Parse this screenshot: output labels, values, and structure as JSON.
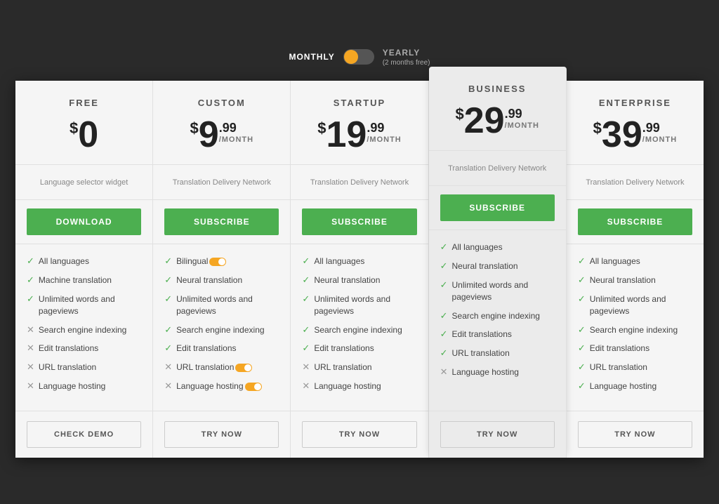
{
  "billing": {
    "monthly_label": "MONTHLY",
    "yearly_label": "YEARLY",
    "yearly_sub": "(2 months free)"
  },
  "plans": [
    {
      "id": "free",
      "name": "FREE",
      "price_symbol": "$",
      "price_amount": "0",
      "price_cents": null,
      "price_month": null,
      "featured": false,
      "description": "Language selector widget",
      "cta_label": "DOWNLOAD",
      "cta_type": "download",
      "features": [
        {
          "check": true,
          "text": "All languages",
          "badge": false
        },
        {
          "check": true,
          "text": "Machine translation",
          "badge": false
        },
        {
          "check": true,
          "text": "Unlimited words and pageviews",
          "badge": false
        },
        {
          "check": false,
          "text": "Search engine indexing",
          "badge": false
        },
        {
          "check": false,
          "text": "Edit translations",
          "badge": false
        },
        {
          "check": false,
          "text": "URL translation",
          "badge": false
        },
        {
          "check": false,
          "text": "Language hosting",
          "badge": false
        }
      ],
      "footer_label": "CHECK DEMO",
      "footer_type": "check-demo"
    },
    {
      "id": "custom",
      "name": "CUSTOM",
      "price_symbol": "$",
      "price_amount": "9",
      "price_cents": ".99",
      "price_month": "/MONTH",
      "featured": false,
      "description": "Translation Delivery Network",
      "cta_label": "SUBSCRIBE",
      "cta_type": "subscribe",
      "features": [
        {
          "check": true,
          "text": "Bilingual",
          "badge": true
        },
        {
          "check": true,
          "text": "Neural translation",
          "badge": false
        },
        {
          "check": true,
          "text": "Unlimited words and pageviews",
          "badge": false
        },
        {
          "check": true,
          "text": "Search engine indexing",
          "badge": false
        },
        {
          "check": true,
          "text": "Edit translations",
          "badge": false
        },
        {
          "check": false,
          "text": "URL translation",
          "badge": true
        },
        {
          "check": false,
          "text": "Language hosting",
          "badge": true
        }
      ],
      "footer_label": "TRY NOW",
      "footer_type": "try-now"
    },
    {
      "id": "startup",
      "name": "STARTUP",
      "price_symbol": "$",
      "price_amount": "19",
      "price_cents": ".99",
      "price_month": "/MONTH",
      "featured": false,
      "description": "Translation Delivery Network",
      "cta_label": "SUBSCRIBE",
      "cta_type": "subscribe",
      "features": [
        {
          "check": true,
          "text": "All languages",
          "badge": false
        },
        {
          "check": true,
          "text": "Neural translation",
          "badge": false
        },
        {
          "check": true,
          "text": "Unlimited words and pageviews",
          "badge": false
        },
        {
          "check": true,
          "text": "Search engine indexing",
          "badge": false
        },
        {
          "check": true,
          "text": "Edit translations",
          "badge": false
        },
        {
          "check": false,
          "text": "URL translation",
          "badge": false
        },
        {
          "check": false,
          "text": "Language hosting",
          "badge": false
        }
      ],
      "footer_label": "TRY NOW",
      "footer_type": "try-now"
    },
    {
      "id": "business",
      "name": "BUSINESS",
      "price_symbol": "$",
      "price_amount": "29",
      "price_cents": ".99",
      "price_month": "/MONTH",
      "featured": true,
      "description": "Translation Delivery Network",
      "cta_label": "SUBSCRIBE",
      "cta_type": "subscribe",
      "features": [
        {
          "check": true,
          "text": "All languages",
          "badge": false
        },
        {
          "check": true,
          "text": "Neural translation",
          "badge": false
        },
        {
          "check": true,
          "text": "Unlimited words and pageviews",
          "badge": false
        },
        {
          "check": true,
          "text": "Search engine indexing",
          "badge": false
        },
        {
          "check": true,
          "text": "Edit translations",
          "badge": false
        },
        {
          "check": true,
          "text": "URL translation",
          "badge": false
        },
        {
          "check": false,
          "text": "Language hosting",
          "badge": false
        }
      ],
      "footer_label": "TRY NOW",
      "footer_type": "try-now"
    },
    {
      "id": "enterprise",
      "name": "ENTERPRISE",
      "price_symbol": "$",
      "price_amount": "39",
      "price_cents": ".99",
      "price_month": "/MONTH",
      "featured": false,
      "description": "Translation Delivery Network",
      "cta_label": "SUBSCRIBE",
      "cta_type": "subscribe",
      "features": [
        {
          "check": true,
          "text": "All languages",
          "badge": false
        },
        {
          "check": true,
          "text": "Neural translation",
          "badge": false
        },
        {
          "check": true,
          "text": "Unlimited words and pageviews",
          "badge": false
        },
        {
          "check": true,
          "text": "Search engine indexing",
          "badge": false
        },
        {
          "check": true,
          "text": "Edit translations",
          "badge": false
        },
        {
          "check": true,
          "text": "URL translation",
          "badge": false
        },
        {
          "check": true,
          "text": "Language hosting",
          "badge": false
        }
      ],
      "footer_label": "TRY NOW",
      "footer_type": "try-now"
    }
  ]
}
